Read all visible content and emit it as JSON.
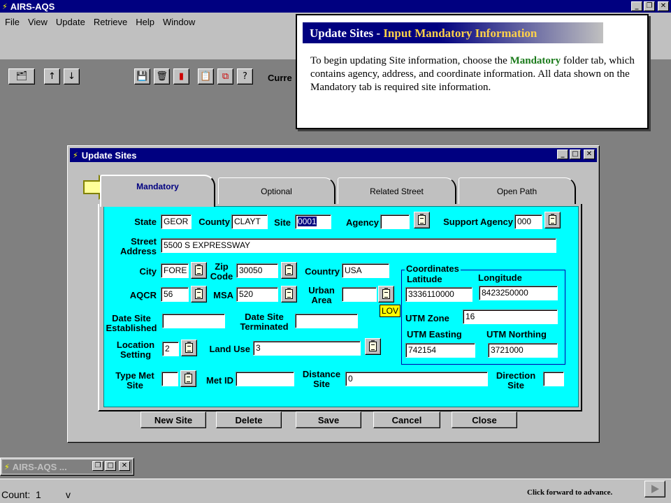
{
  "app": {
    "title": "AIRS-AQS"
  },
  "menu": [
    "File",
    "View",
    "Update",
    "Retrieve",
    "Help",
    "Window"
  ],
  "toolbar": {
    "current_label": "Curre"
  },
  "callout": {
    "title_prefix": "Update Sites - ",
    "title_highlight": "Input Mandatory Information",
    "body_before": "To begin updating Site information, choose the ",
    "body_keyword": "Mandatory",
    "body_after": " folder tab, which contains agency, address, and coordinate information.  All data shown on the Mandatory tab is required site information."
  },
  "dialog": {
    "title": "Update Sites",
    "tabs": [
      "Mandatory",
      "Optional",
      "Related Street",
      "Open Path"
    ],
    "labels": {
      "state": "State",
      "county": "County",
      "site": "Site",
      "agency": "Agency",
      "support_agency": "Support Agency",
      "street_address": "Street\nAddress",
      "city": "City",
      "zip_code": "Zip\nCode",
      "country": "Country",
      "aqcr": "AQCR",
      "msa": "MSA",
      "urban_area": "Urban\nArea",
      "date_established": "Date Site\nEstablished",
      "date_terminated": "Date Site\nTerminated",
      "location_setting": "Location\nSetting",
      "land_use": "Land Use",
      "type_met_site": "Type Met\nSite",
      "met_id": "Met ID",
      "distance_site": "Distance\nSite",
      "direction_site": "Direction\nSite",
      "coordinates": "Coordinates",
      "latitude": "Latitude",
      "longitude": "Longitude",
      "utm_zone": "UTM Zone",
      "utm_easting": "UTM Easting",
      "utm_northing": "UTM Northing",
      "lov": "LOV"
    },
    "values": {
      "state": "GEOR",
      "county": "CLAYT",
      "site": "0001",
      "agency": "",
      "support_agency": "000",
      "street_address": "5500 S EXPRESSWAY",
      "city": "FORE",
      "zip_code": "30050",
      "country": "USA",
      "aqcr": "56",
      "msa": "520",
      "urban_area": "",
      "date_established": "",
      "date_terminated": "",
      "location_setting": "2",
      "land_use": "3",
      "type_met_site": "",
      "met_id": "",
      "distance_site": "0",
      "direction_site": "",
      "latitude": "3336110000",
      "longitude": "8423250000",
      "utm_zone": "16",
      "utm_easting": "742154",
      "utm_northing": "3721000"
    },
    "buttons": [
      "New Site",
      "Delete",
      "Save",
      "Cancel",
      "Close"
    ]
  },
  "minimized": {
    "title": "AIRS-AQS ..."
  },
  "status": {
    "count": "Count:  1",
    "mode": "v",
    "hint": "Click forward to advance."
  }
}
